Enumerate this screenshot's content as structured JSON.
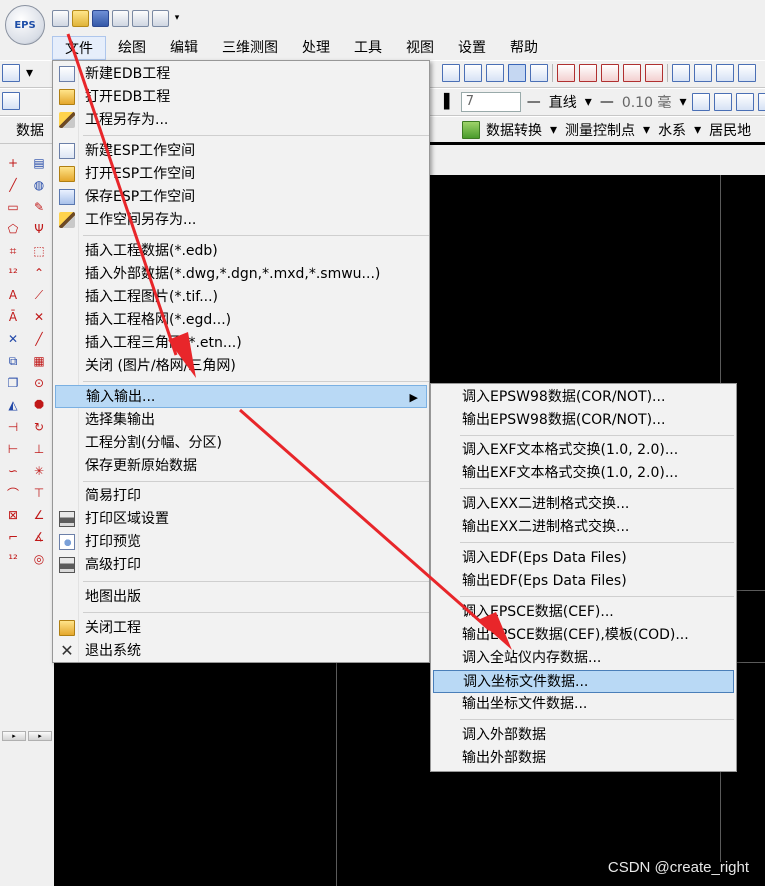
{
  "app": {
    "logo_text": "EPS"
  },
  "menu_bar": [
    "文件",
    "绘图",
    "编辑",
    "三维测图",
    "处理",
    "工具",
    "视图",
    "设置",
    "帮助"
  ],
  "toolbar": {
    "color_value": "7",
    "line_value": "直线",
    "width_value": "0.10 毫",
    "row1_label": "数据",
    "convert_label": "数据转换",
    "control_label": "测量控制点",
    "water_label": "水系",
    "resident_label": "居民地"
  },
  "file_menu": {
    "items": [
      {
        "label": "新建EDB工程",
        "icon": "new-doc-icon"
      },
      {
        "label": "打开EDB工程",
        "icon": "open-folder-icon"
      },
      {
        "label": "工程另存为...",
        "icon": "save-as-brush-icon"
      },
      {
        "label": "新建ESP工作空间",
        "icon": "new-doc-icon"
      },
      {
        "label": "打开ESP工作空间",
        "icon": "open-folder-icon"
      },
      {
        "label": "保存ESP工作空间",
        "icon": "copy-icon"
      },
      {
        "label": "工作空间另存为...",
        "icon": "save-as-brush-icon"
      },
      {
        "label": "插入工程数据(*.edb)",
        "icon": ""
      },
      {
        "label": "插入外部数据(*.dwg,*.dgn,*.mxd,*.smwu...)",
        "icon": ""
      },
      {
        "label": "插入工程图片(*.tif...)",
        "icon": ""
      },
      {
        "label": "插入工程格网(*.egd...)",
        "icon": ""
      },
      {
        "label": "插入工程三角网(*.etn...)",
        "icon": ""
      },
      {
        "label": "关闭 (图片/格网/三角网)",
        "icon": ""
      },
      {
        "label": "输入输出...",
        "icon": ""
      },
      {
        "label": "选择集输出",
        "icon": ""
      },
      {
        "label": "工程分割(分幅、分区)",
        "icon": ""
      },
      {
        "label": "保存更新原始数据",
        "icon": ""
      },
      {
        "label": "简易打印",
        "icon": ""
      },
      {
        "label": "打印区域设置",
        "icon": "printer-icon"
      },
      {
        "label": "打印预览",
        "icon": "print-preview-icon"
      },
      {
        "label": "高级打印",
        "icon": "printer-icon"
      },
      {
        "label": "地图出版",
        "icon": ""
      },
      {
        "label": "关闭工程",
        "icon": "open-folder-icon"
      },
      {
        "label": "退出系统",
        "icon": "close-icon"
      }
    ]
  },
  "io_submenu": {
    "items": [
      "调入EPSW98数据(COR/NOT)...",
      "输出EPSW98数据(COR/NOT)...",
      "调入EXF文本格式交换(1.0, 2.0)...",
      "输出EXF文本格式交换(1.0, 2.0)...",
      "调入EXX二进制格式交换...",
      "输出EXX二进制格式交换...",
      "调入EDF(Eps Data Files)",
      "输出EDF(Eps Data Files)",
      "调入EPSCE数据(CEF)...",
      "输出EPSCE数据(CEF),模板(COD)...",
      "调入全站仪内存数据...",
      "调入坐标文件数据...",
      "输出坐标文件数据...",
      "调入外部数据",
      "输出外部数据"
    ]
  },
  "colors": {
    "highlight": "#b9d9f5",
    "annotation": "#e8262a",
    "canvas": "#000000"
  },
  "watermark": "CSDN @create_right"
}
